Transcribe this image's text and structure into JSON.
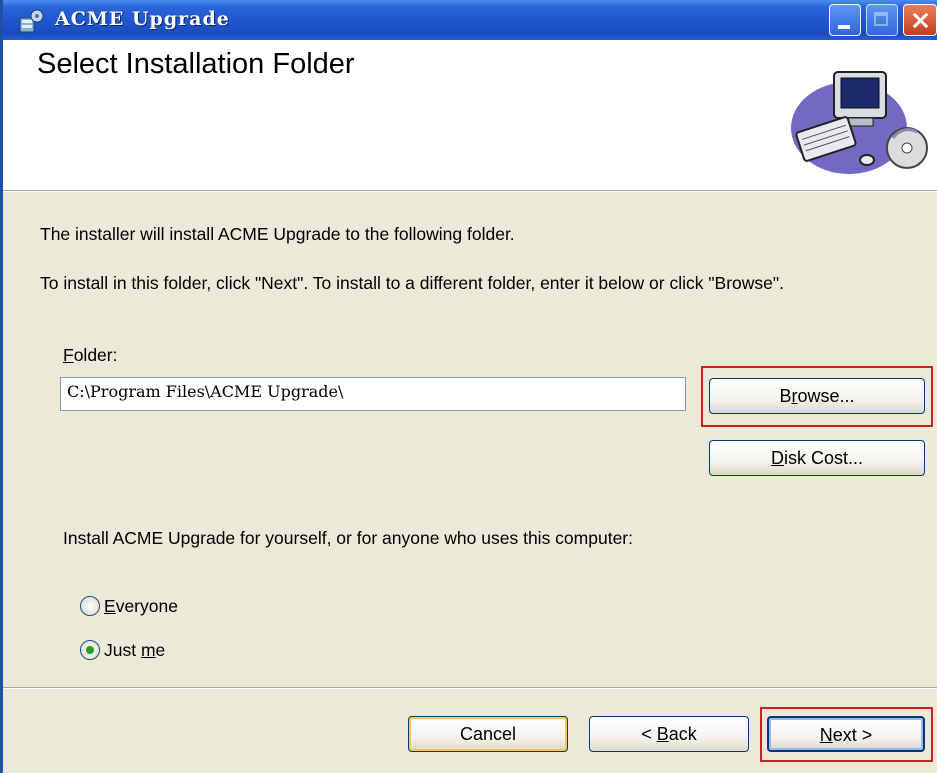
{
  "window": {
    "title": "ACME Upgrade"
  },
  "header": {
    "title": "Select Installation Folder"
  },
  "intro": {
    "line1": "The installer will install ACME Upgrade to the following folder.",
    "line2": "To install in this folder, click \"Next\". To install to a different folder, enter it below or click \"Browse\"."
  },
  "folder": {
    "label_mnemonic": "F",
    "label_rest": "older:",
    "value": "C:\\Program Files\\ACME Upgrade\\"
  },
  "buttons": {
    "browse_pre": "B",
    "browse_mnemonic": "r",
    "browse_post": "owse...",
    "diskcost_mnemonic": "D",
    "diskcost_rest": "isk Cost...",
    "cancel": "Cancel",
    "back_pre": "< ",
    "back_mnemonic": "B",
    "back_rest": "ack",
    "next_mnemonic": "N",
    "next_rest": "ext >"
  },
  "install_for": {
    "question": "Install ACME Upgrade for yourself, or for anyone who uses this computer:",
    "options": [
      {
        "mnemonic": "E",
        "rest": "veryone",
        "selected": false
      },
      {
        "pre": "Just ",
        "mnemonic": "m",
        "rest": "e",
        "selected": true
      }
    ]
  },
  "colors": {
    "titlebar": "#2a64d8",
    "highlight_box": "#cc2020",
    "dialog_bg": "#ece9d8"
  }
}
